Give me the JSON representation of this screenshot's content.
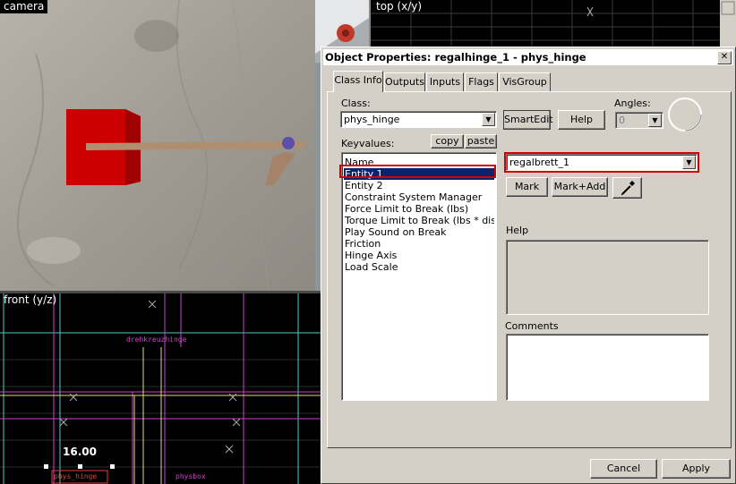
{
  "viewports": {
    "camera_label": "camera",
    "top_label": "top (x/y)",
    "front_label": "front (y/z)",
    "front_text_1": "drehkreuzhinge",
    "front_measure": "16.00",
    "front_text_2": "phys_hinge",
    "front_text_3": "physbox"
  },
  "dialog": {
    "title": "Object Properties: regalhinge_1 - phys_hinge",
    "close_glyph": "✕",
    "tabs": [
      "Class Info",
      "Outputs",
      "Inputs",
      "Flags",
      "VisGroup"
    ],
    "class_label": "Class:",
    "class_value": "phys_hinge",
    "smartedit_label": "SmartEdit",
    "help_button_label": "Help",
    "angles_label": "Angles:",
    "angles_value": "0",
    "keyvalues_label": "Keyvalues:",
    "copy_label": "copy",
    "paste_label": "paste",
    "keyvalues": [
      "Name",
      "Entity 1",
      "Entity 2",
      "Constraint System Manager",
      "Force Limit to Break (lbs)",
      "Torque Limit to Break (lbs * distance)",
      "Play Sound on Break",
      "Friction",
      "Hinge Axis",
      "Load Scale"
    ],
    "selected_key": "Entity 1",
    "value_combo": "regalbrett_1",
    "mark_label": "Mark",
    "markadd_label": "Mark+Add",
    "eyedropper_icon": "eyedropper-icon",
    "help_section_label": "Help",
    "comments_label": "Comments",
    "cancel_label": "Cancel",
    "apply_label": "Apply",
    "accent_red": "#d40000",
    "selection_color": "#0a246a"
  }
}
